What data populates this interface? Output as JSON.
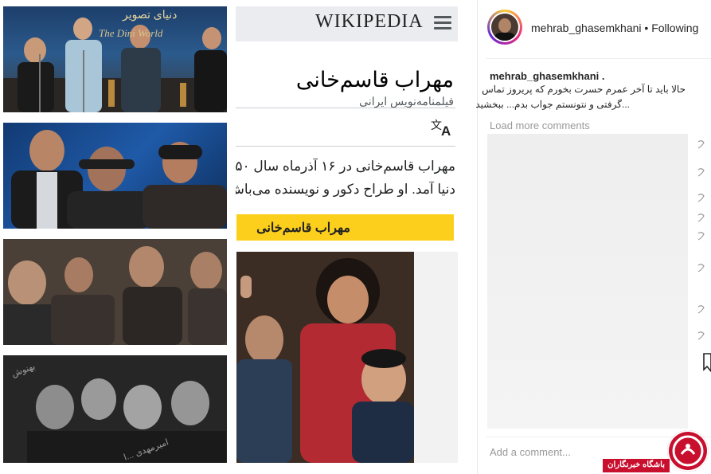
{
  "photos": {
    "top_banner_text": "دنیای تصویر",
    "top_banner_sub": "The Dini World",
    "watermark_left": "بهنوش",
    "watermark_bottom": "امیرمهدی ...ا"
  },
  "wikipedia": {
    "logo": "WIKIPEDIA",
    "title": "مهراب قاسم‌خانی",
    "subtitle": "فیلمنامه‌نویس ایرانی",
    "body_line1": "مهراب قاسم‌خانی در ۱۶ آذرماه سال ۵۰",
    "body_line2": "دنیا آمد. او طراح دکور و نویسنده می‌باش",
    "highlight_bar": "مهراب قاسم‌خانی",
    "translate_icon": "translate-icon"
  },
  "instagram": {
    "username": "mehrab_ghasemkhani",
    "follow_sep": "•",
    "follow_status": "Following",
    "caption_user": "mehrab_ghasemkhani .",
    "caption_line1": "حالا باید تا آخر عمرم حسرت بخورم که پریروز تماس",
    "caption_line2": "...گرفتی و نتونستم جواب بدم... ببخشید",
    "load_more": "Load more comments",
    "add_comment_placeholder": "Add a comment...",
    "more": "...",
    "accent": "#262626"
  },
  "brand": {
    "name": "باشگاه خبرنگاران",
    "color": "#c8102e"
  }
}
